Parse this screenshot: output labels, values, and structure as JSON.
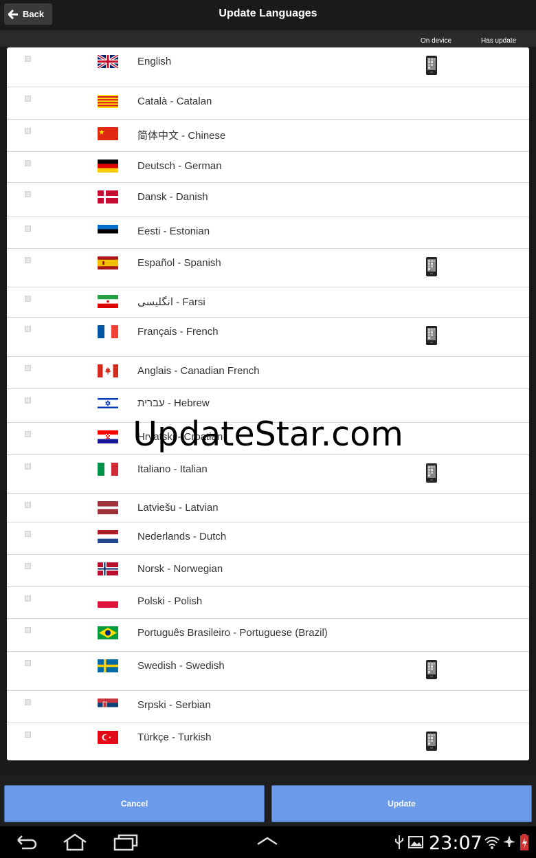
{
  "header": {
    "back_label": "Back",
    "title": "Update Languages"
  },
  "columns": {
    "on_device": "On device",
    "has_update": "Has update"
  },
  "languages": [
    {
      "label": "English",
      "flag": "gb",
      "on_device": true
    },
    {
      "label": "Català - Catalan",
      "flag": "ca",
      "on_device": false
    },
    {
      "label": "简体中文 - Chinese",
      "flag": "cn",
      "on_device": false
    },
    {
      "label": "Deutsch - German",
      "flag": "de",
      "on_device": false
    },
    {
      "label": "Dansk - Danish",
      "flag": "dk",
      "on_device": false
    },
    {
      "label": "Eesti - Estonian",
      "flag": "ee",
      "on_device": false
    },
    {
      "label": "Español - Spanish",
      "flag": "es",
      "on_device": true
    },
    {
      "label": "انگلیسی - Farsi",
      "flag": "ir",
      "on_device": false
    },
    {
      "label": "Français - French",
      "flag": "fr",
      "on_device": true
    },
    {
      "label": "Anglais - Canadian French",
      "flag": "cafr",
      "on_device": false
    },
    {
      "label": "עברית - Hebrew",
      "flag": "il",
      "on_device": false
    },
    {
      "label": "Hrvatski - Croatian",
      "flag": "hr",
      "on_device": false
    },
    {
      "label": "Italiano - Italian",
      "flag": "it",
      "on_device": true
    },
    {
      "label": "Latviešu - Latvian",
      "flag": "lv",
      "on_device": false
    },
    {
      "label": "Nederlands - Dutch",
      "flag": "nl",
      "on_device": false
    },
    {
      "label": "Norsk - Norwegian",
      "flag": "no",
      "on_device": false
    },
    {
      "label": "Polski - Polish",
      "flag": "pl",
      "on_device": false
    },
    {
      "label": "Português Brasileiro - Portuguese (Brazil)",
      "flag": "br",
      "on_device": false
    },
    {
      "label": "Swedish - Swedish",
      "flag": "se",
      "on_device": true
    },
    {
      "label": "Srpski - Serbian",
      "flag": "rs",
      "on_device": false
    },
    {
      "label": "Türkçe - Turkish",
      "flag": "tr",
      "on_device": true
    }
  ],
  "watermark": "UpdateStar.com",
  "buttons": {
    "cancel": "Cancel",
    "update": "Update"
  },
  "status": {
    "time": "23:07"
  },
  "colors": {
    "button": "#6b9ae8",
    "bar": "#1a1a1a"
  },
  "icons": {
    "device": "phone-icon",
    "back": "arrow-left-icon"
  }
}
